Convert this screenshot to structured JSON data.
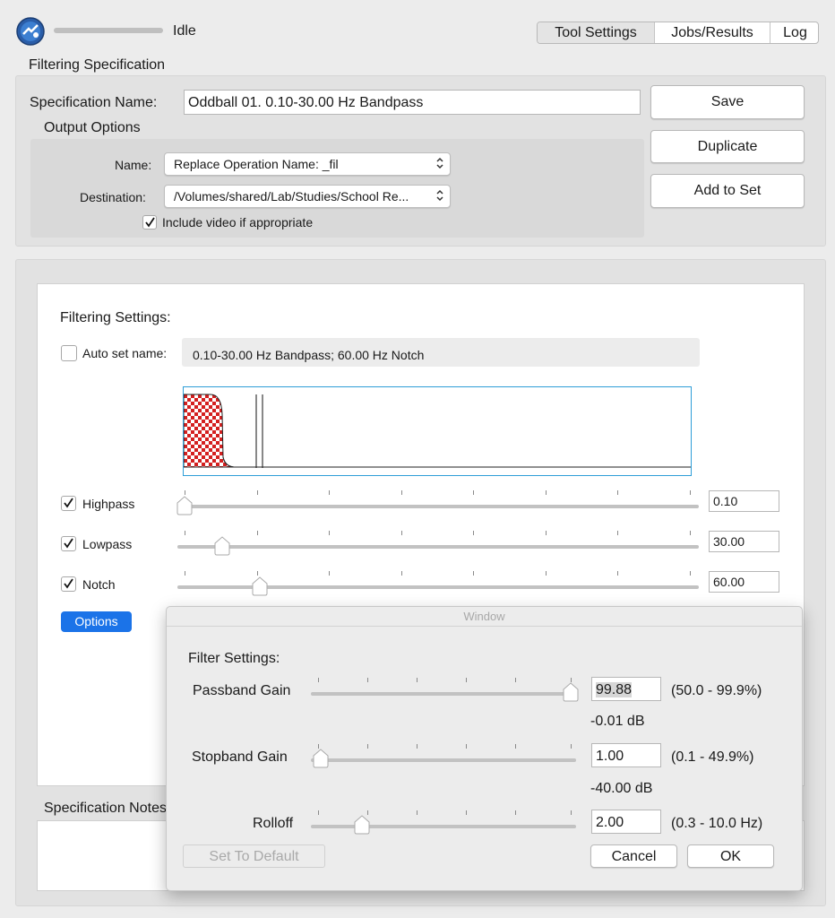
{
  "status": {
    "text": "Idle"
  },
  "tabs": [
    "Tool Settings",
    "Jobs/Results",
    "Log"
  ],
  "spec": {
    "section_title": "Filtering Specification",
    "name_label": "Specification Name:",
    "name_value": "Oddball 01. 0.10-30.00 Hz Bandpass",
    "output_title": "Output Options",
    "name_field_label": "Name:",
    "name_popup": "Replace Operation Name: _fil",
    "destination_label": "Destination:",
    "destination_popup": "/Volumes/shared/Lab/Studies/School Re...",
    "include_video_label": "Include video if appropriate",
    "include_video_checked": true
  },
  "side_buttons": {
    "save": "Save",
    "duplicate": "Duplicate",
    "add_to_set": "Add to Set"
  },
  "filtering": {
    "title": "Filtering Settings:",
    "auto_set_label": "Auto set name:",
    "auto_set_checked": false,
    "auto_name": "0.10-30.00 Hz Bandpass; 60.00 Hz Notch",
    "highpass_label": "Highpass",
    "highpass_value": "0.10",
    "lowpass_label": "Lowpass",
    "lowpass_value": "30.00",
    "notch_label": "Notch",
    "notch_value": "60.00",
    "options_button": "Options",
    "accent_color": "#1b73e8"
  },
  "notes": {
    "title": "Specification Notes"
  },
  "dialog": {
    "window_title": "Window",
    "title": "Filter Settings:",
    "passband_label": "Passband Gain",
    "passband_value": "99.88",
    "passband_range": "(50.0 - 99.9%)",
    "passband_db": "-0.01 dB",
    "stopband_label": "Stopband Gain",
    "stopband_value": "1.00",
    "stopband_range": "(0.1 - 49.9%)",
    "stopband_db": "-40.00 dB",
    "rolloff_label": "Rolloff",
    "rolloff_value": "2.00",
    "rolloff_range": "(0.3 - 10.0 Hz)",
    "set_default": "Set To Default",
    "cancel": "Cancel",
    "ok": "OK"
  }
}
